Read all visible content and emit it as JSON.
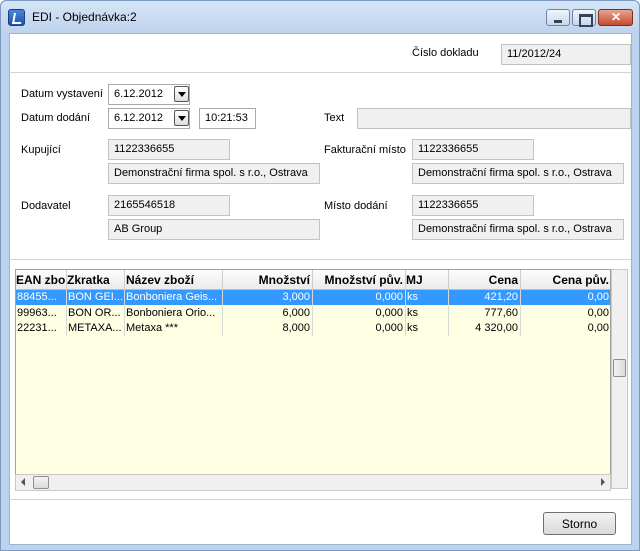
{
  "window": {
    "title": "EDI - Objednávka:2"
  },
  "form": {
    "cislo_dokladu_label": "Číslo dokladu",
    "cislo_dokladu": "11/2012/24",
    "datum_vystaveni_label": "Datum vystavení",
    "datum_vystaveni": "6.12.2012",
    "datum_dodani_label": "Datum dodání",
    "datum_dodani": "6.12.2012",
    "cas_dodani": "10:21:53",
    "text_label": "Text",
    "text_value": "",
    "kupujici_label": "Kupující",
    "kupujici_code": "1122336655",
    "kupujici_name": "Demonstrační firma spol. s r.o., Ostrava",
    "fakturacni_label": "Fakturační místo",
    "fakturacni_code": "1122336655",
    "fakturacni_name": "Demonstrační firma spol. s r.o., Ostrava",
    "dodavatel_label": "Dodavatel",
    "dodavatel_code": "2165546518",
    "dodavatel_name": "AB Group",
    "misto_dodani_label": "Místo dodání",
    "misto_dodani_code": "1122336655",
    "misto_dodani_name": "Demonstrační firma spol. s r.o., Ostrava"
  },
  "grid": {
    "columns": [
      "EAN zbo",
      "Zkratka",
      "Název zboží",
      "Množství",
      "Množství pův.",
      "MJ",
      "Cena",
      "Cena pův."
    ],
    "rows": [
      [
        "88455...",
        "BON GEI...",
        "Bonboniera Geis...",
        "3,000",
        "0,000",
        "ks",
        "421,20",
        "0,00"
      ],
      [
        "99963...",
        "BON OR...",
        "Bonboniera Orio...",
        "6,000",
        "0,000",
        "ks",
        "777,60",
        "0,00"
      ],
      [
        "22231...",
        "METAXA...",
        "Metaxa ***",
        "8,000",
        "0,000",
        "ks",
        "4 320,00",
        "0,00"
      ]
    ],
    "selected_row": 0
  },
  "buttons": {
    "storno": "Storno"
  },
  "colors": {
    "grid_background": "#ffffe4",
    "selection": "#3399ff"
  }
}
